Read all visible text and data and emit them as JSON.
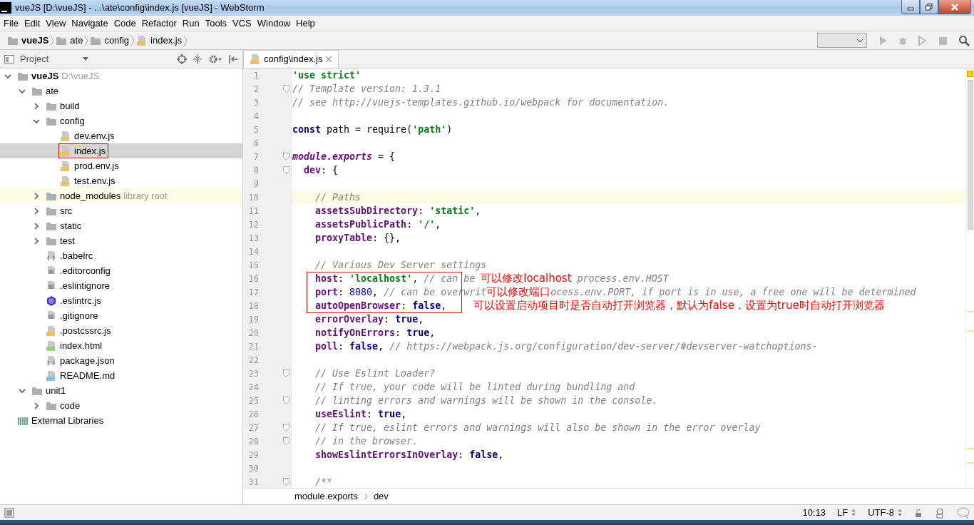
{
  "window": {
    "title": "vueJS [D:\\vueJS] - ...\\ate\\config\\index.js [vueJS] - WebStorm"
  },
  "menu": [
    "File",
    "Edit",
    "View",
    "Navigate",
    "Code",
    "Refactor",
    "Run",
    "Tools",
    "VCS",
    "Window",
    "Help"
  ],
  "breadcrumbs": [
    {
      "label": "vueJS",
      "kind": "project"
    },
    {
      "label": "ate",
      "kind": "folder"
    },
    {
      "label": "config",
      "kind": "folder"
    },
    {
      "label": "index.js",
      "kind": "js"
    }
  ],
  "toolbar": {
    "run_buttons_disabled": true
  },
  "project_panel": {
    "title": "Project"
  },
  "tree": [
    {
      "label": "vueJS",
      "kind": "project",
      "hint": "D:\\vueJS",
      "expanded": true,
      "selected": false,
      "marked": false,
      "library_root": false,
      "children": [
        {
          "label": "ate",
          "kind": "folder",
          "expanded": true,
          "selected": false,
          "marked": false,
          "library_root": false,
          "children": [
            {
              "label": "build",
              "kind": "folder",
              "expanded": false,
              "selected": false,
              "marked": false,
              "library_root": false
            },
            {
              "label": "config",
              "kind": "folder",
              "expanded": true,
              "selected": false,
              "marked": false,
              "library_root": false,
              "children": [
                {
                  "label": "dev.env.js",
                  "kind": "js",
                  "selected": false,
                  "marked": false,
                  "library_root": false
                },
                {
                  "label": "index.js",
                  "kind": "js",
                  "selected": true,
                  "marked": true,
                  "library_root": false
                },
                {
                  "label": "prod.env.js",
                  "kind": "js",
                  "selected": false,
                  "marked": false,
                  "library_root": false
                },
                {
                  "label": "test.env.js",
                  "kind": "js",
                  "selected": false,
                  "marked": false,
                  "library_root": false
                }
              ]
            },
            {
              "label": "node_modules",
              "kind": "folder",
              "hint": "library root",
              "expanded": false,
              "selected": false,
              "marked": false,
              "library_root": true
            },
            {
              "label": "src",
              "kind": "folder",
              "expanded": false,
              "selected": false,
              "marked": false,
              "library_root": false
            },
            {
              "label": "static",
              "kind": "folder",
              "expanded": false,
              "selected": false,
              "marked": false,
              "library_root": false
            },
            {
              "label": "test",
              "kind": "folder",
              "expanded": false,
              "selected": false,
              "marked": false,
              "library_root": false
            },
            {
              "label": ".babelrc",
              "kind": "json",
              "selected": false,
              "marked": false,
              "library_root": false
            },
            {
              "label": ".editorconfig",
              "kind": "text",
              "selected": false,
              "marked": false,
              "library_root": false
            },
            {
              "label": ".eslintignore",
              "kind": "text",
              "selected": false,
              "marked": false,
              "library_root": false
            },
            {
              "label": ".eslintrc.js",
              "kind": "eslint",
              "selected": false,
              "marked": false,
              "library_root": false
            },
            {
              "label": ".gitignore",
              "kind": "text",
              "selected": false,
              "marked": false,
              "library_root": false
            },
            {
              "label": ".postcssrc.js",
              "kind": "js",
              "selected": false,
              "marked": false,
              "library_root": false
            },
            {
              "label": "index.html",
              "kind": "html",
              "selected": false,
              "marked": false,
              "library_root": false
            },
            {
              "label": "package.json",
              "kind": "json",
              "selected": false,
              "marked": false,
              "library_root": false
            },
            {
              "label": "README.md",
              "kind": "md",
              "selected": false,
              "marked": false,
              "library_root": false
            }
          ]
        },
        {
          "label": "unit1",
          "kind": "folder",
          "expanded": true,
          "selected": false,
          "marked": false,
          "library_root": false,
          "children": [
            {
              "label": "code",
              "kind": "folder",
              "expanded": false,
              "selected": false,
              "marked": false,
              "library_root": false
            }
          ]
        }
      ]
    },
    {
      "label": "External Libraries",
      "kind": "libs",
      "selected": false,
      "marked": false,
      "library_root": false
    }
  ],
  "tabs": [
    {
      "label": "config\\index.js",
      "selected": true
    }
  ],
  "code_lines": [
    {
      "number": "1",
      "current": false,
      "fold": false,
      "boxed": false,
      "tokens": [
        {
          "kind": "str",
          "text": "'use strict'"
        }
      ]
    },
    {
      "number": "2",
      "current": false,
      "fold": true,
      "boxed": false,
      "tokens": [
        {
          "kind": "com",
          "text": "// Template version: 1.3.1"
        }
      ]
    },
    {
      "number": "3",
      "current": false,
      "fold": false,
      "boxed": false,
      "tokens": [
        {
          "kind": "com",
          "text": "// see http://vuejs-templates.github.io/webpack for documentation."
        }
      ]
    },
    {
      "number": "4",
      "current": false,
      "fold": false,
      "boxed": false
    },
    {
      "number": "5",
      "current": false,
      "fold": false,
      "boxed": false,
      "tokens": [
        {
          "kind": "kw",
          "text": "const"
        },
        {
          "kind": "plain",
          "text": " path = require("
        },
        {
          "kind": "str",
          "text": "'path'"
        },
        {
          "kind": "plain",
          "text": ")"
        }
      ]
    },
    {
      "number": "6",
      "current": false,
      "fold": false,
      "boxed": false
    },
    {
      "number": "7",
      "current": false,
      "fold": true,
      "boxed": false,
      "tokens": [
        {
          "kind": "ital",
          "text": "module.exports"
        },
        {
          "kind": "plain",
          "text": " = {"
        }
      ]
    },
    {
      "number": "8",
      "current": false,
      "fold": true,
      "boxed": false,
      "tokens": [
        {
          "kind": "prop",
          "text": "  dev"
        },
        {
          "kind": "plain",
          "text": ": {"
        }
      ]
    },
    {
      "number": "9",
      "current": false,
      "fold": false,
      "boxed": false
    },
    {
      "number": "10",
      "current": true,
      "fold": false,
      "boxed": false,
      "tokens": [
        {
          "kind": "com",
          "text": "    // Paths"
        }
      ]
    },
    {
      "number": "11",
      "current": false,
      "fold": false,
      "boxed": false,
      "tokens": [
        {
          "kind": "prop",
          "text": "    assetsSubDirectory"
        },
        {
          "kind": "plain",
          "text": ": "
        },
        {
          "kind": "str",
          "text": "'static'"
        },
        {
          "kind": "plain",
          "text": ","
        }
      ]
    },
    {
      "number": "12",
      "current": false,
      "fold": false,
      "boxed": false,
      "tokens": [
        {
          "kind": "prop",
          "text": "    assetsPublicPath"
        },
        {
          "kind": "plain",
          "text": ": "
        },
        {
          "kind": "str",
          "text": "'/'"
        },
        {
          "kind": "plain",
          "text": ","
        }
      ]
    },
    {
      "number": "13",
      "current": false,
      "fold": false,
      "boxed": false,
      "tokens": [
        {
          "kind": "prop",
          "text": "    proxyTable"
        },
        {
          "kind": "plain",
          "text": ": {},"
        }
      ]
    },
    {
      "number": "14",
      "current": false,
      "fold": false,
      "boxed": false
    },
    {
      "number": "15",
      "current": false,
      "fold": false,
      "boxed": false,
      "tokens": [
        {
          "kind": "com",
          "text": "    // Various Dev Server settings"
        }
      ]
    },
    {
      "number": "16",
      "current": false,
      "fold": false,
      "boxed": true,
      "tokens": [
        {
          "kind": "prop",
          "text": "    host"
        },
        {
          "kind": "plain",
          "text": ": "
        },
        {
          "kind": "str",
          "text": "'localhost'"
        },
        {
          "kind": "plain",
          "text": ", "
        },
        {
          "kind": "com",
          "text": "// can be "
        },
        {
          "kind": "note",
          "text": "可以修改localhost"
        },
        {
          "kind": "com",
          "text": " process.env.HOST"
        }
      ]
    },
    {
      "number": "17",
      "current": false,
      "fold": false,
      "boxed": true,
      "tokens": [
        {
          "kind": "prop",
          "text": "    port"
        },
        {
          "kind": "plain",
          "text": ": "
        },
        {
          "kind": "num",
          "text": "8080"
        },
        {
          "kind": "plain",
          "text": ", "
        },
        {
          "kind": "com",
          "text": "// can be overwrit"
        },
        {
          "kind": "note",
          "text": "可以修改端口"
        },
        {
          "kind": "com",
          "text": "ocess.env.PORT, if port is in use, a free one will be determined"
        }
      ]
    },
    {
      "number": "18",
      "current": false,
      "fold": false,
      "boxed": true,
      "tokens": [
        {
          "kind": "prop",
          "text": "    autoOpenBrowser"
        },
        {
          "kind": "plain",
          "text": ": "
        },
        {
          "kind": "kw",
          "text": "false"
        },
        {
          "kind": "plain",
          "text": ","
        },
        {
          "kind": "note",
          "text": "可以设置启动项目时是否自动打开浏览器，默认为false，设置为true时自动打开浏览器"
        }
      ]
    },
    {
      "number": "19",
      "current": false,
      "fold": false,
      "boxed": false,
      "tokens": [
        {
          "kind": "prop",
          "text": "    errorOverlay"
        },
        {
          "kind": "plain",
          "text": ": "
        },
        {
          "kind": "kw",
          "text": "true"
        },
        {
          "kind": "plain",
          "text": ","
        }
      ]
    },
    {
      "number": "20",
      "current": false,
      "fold": false,
      "boxed": false,
      "tokens": [
        {
          "kind": "prop",
          "text": "    notifyOnErrors"
        },
        {
          "kind": "plain",
          "text": ": "
        },
        {
          "kind": "kw",
          "text": "true"
        },
        {
          "kind": "plain",
          "text": ","
        }
      ]
    },
    {
      "number": "21",
      "current": false,
      "fold": false,
      "boxed": false,
      "tokens": [
        {
          "kind": "prop",
          "text": "    poll"
        },
        {
          "kind": "plain",
          "text": ": "
        },
        {
          "kind": "kw",
          "text": "false"
        },
        {
          "kind": "plain",
          "text": ", "
        },
        {
          "kind": "com",
          "text": "// https://webpack.js.org/configuration/dev-server/#devserver-watchoptions-"
        }
      ]
    },
    {
      "number": "22",
      "current": false,
      "fold": false,
      "boxed": false
    },
    {
      "number": "23",
      "current": false,
      "fold": true,
      "boxed": false,
      "tokens": [
        {
          "kind": "com",
          "text": "    // Use Eslint Loader?"
        }
      ]
    },
    {
      "number": "24",
      "current": false,
      "fold": false,
      "boxed": false,
      "tokens": [
        {
          "kind": "com",
          "text": "    // If true, your code will be linted during bundling and"
        }
      ]
    },
    {
      "number": "25",
      "current": false,
      "fold": true,
      "boxed": false,
      "tokens": [
        {
          "kind": "com",
          "text": "    // linting errors and warnings will be shown in the console."
        }
      ]
    },
    {
      "number": "26",
      "current": false,
      "fold": false,
      "boxed": false,
      "tokens": [
        {
          "kind": "prop",
          "text": "    useEslint"
        },
        {
          "kind": "plain",
          "text": ": "
        },
        {
          "kind": "kw",
          "text": "true"
        },
        {
          "kind": "plain",
          "text": ","
        }
      ]
    },
    {
      "number": "27",
      "current": false,
      "fold": true,
      "boxed": false,
      "tokens": [
        {
          "kind": "com",
          "text": "    // If true, eslint errors and warnings will also be shown in the error overlay"
        }
      ]
    },
    {
      "number": "28",
      "current": false,
      "fold": true,
      "boxed": false,
      "tokens": [
        {
          "kind": "com",
          "text": "    // in the browser."
        }
      ]
    },
    {
      "number": "29",
      "current": false,
      "fold": false,
      "boxed": false,
      "tokens": [
        {
          "kind": "prop",
          "text": "    showEslintErrorsInOverlay"
        },
        {
          "kind": "plain",
          "text": ": "
        },
        {
          "kind": "kw",
          "text": "false"
        },
        {
          "kind": "plain",
          "text": ","
        }
      ]
    },
    {
      "number": "30",
      "current": false,
      "fold": false,
      "boxed": false
    },
    {
      "number": "31",
      "current": false,
      "fold": true,
      "boxed": false,
      "tokens": [
        {
          "kind": "com",
          "text": "    /**"
        }
      ]
    }
  ],
  "editor_breadcrumbs": [
    "module.exports",
    "dev"
  ],
  "status_bar": {
    "position": "10:13",
    "line_separator": "LF",
    "encoding": "UTF-8"
  }
}
